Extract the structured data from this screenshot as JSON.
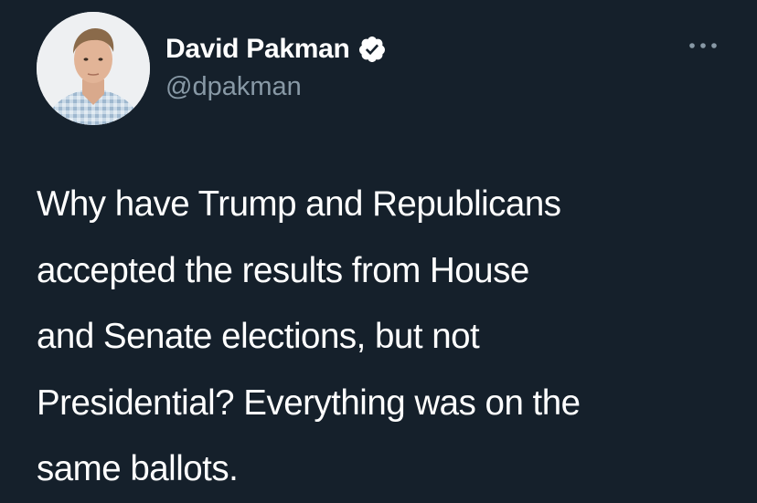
{
  "author": {
    "display_name": "David Pakman",
    "handle": "@dpakman",
    "verified": true,
    "avatar_icon": "profile-photo"
  },
  "tweet": {
    "lines": [
      "Why have Trump and Republicans",
      "accepted the results from House",
      "and Senate elections, but not",
      "Presidential? Everything was on the",
      "same ballots."
    ]
  },
  "menu": {
    "icon": "more-options-icon"
  },
  "colors": {
    "background": "#15202b",
    "text_primary": "#ffffff",
    "text_secondary": "#8899a6",
    "verified_badge": "#ffffff"
  }
}
